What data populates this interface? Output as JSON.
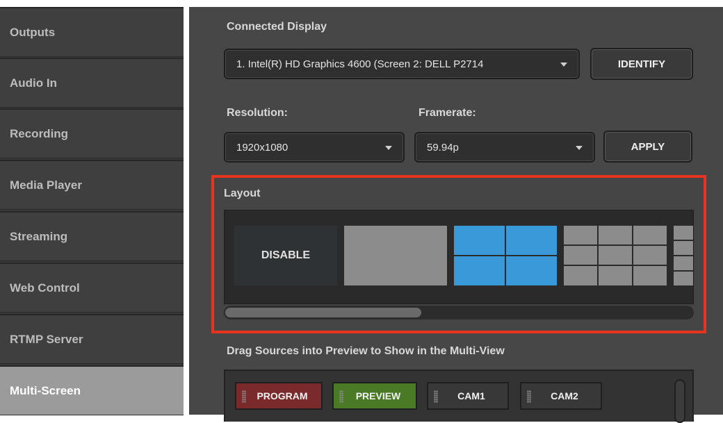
{
  "sidebar": {
    "items": [
      {
        "label": "Outputs",
        "active": false
      },
      {
        "label": "Audio In",
        "active": false
      },
      {
        "label": "Recording",
        "active": false
      },
      {
        "label": "Media Player",
        "active": false
      },
      {
        "label": "Streaming",
        "active": false
      },
      {
        "label": "Web Control",
        "active": false
      },
      {
        "label": "RTMP Server",
        "active": false
      },
      {
        "label": "Multi-Screen",
        "active": true
      }
    ]
  },
  "display": {
    "label": "Connected Display",
    "value": "1. Intel(R) HD Graphics 4600 (Screen 2: DELL P2714",
    "identify_label": "IDENTIFY"
  },
  "resolution": {
    "label": "Resolution:",
    "value": "1920x1080"
  },
  "framerate": {
    "label": "Framerate:",
    "value": "59.94p"
  },
  "apply_label": "APPLY",
  "layout": {
    "label": "Layout",
    "disable_label": "DISABLE",
    "options": [
      "disable",
      "single",
      "2x2",
      "3x3",
      "4x4"
    ],
    "selected": "2x2",
    "scroll_fraction": 0.42
  },
  "sources": {
    "label": "Drag Sources into Preview to Show in the Multi-View",
    "chips": [
      {
        "label": "PROGRAM",
        "color": "#7a2a2a"
      },
      {
        "label": "PREVIEW",
        "color": "#4b7a26"
      },
      {
        "label": "CAM1",
        "color": "#383838"
      },
      {
        "label": "CAM2",
        "color": "#383838"
      }
    ]
  },
  "colors": {
    "highlight": "#e8341f",
    "selected_layout": "#3a9ad9",
    "active_sidebar": "#9b9b9b"
  }
}
